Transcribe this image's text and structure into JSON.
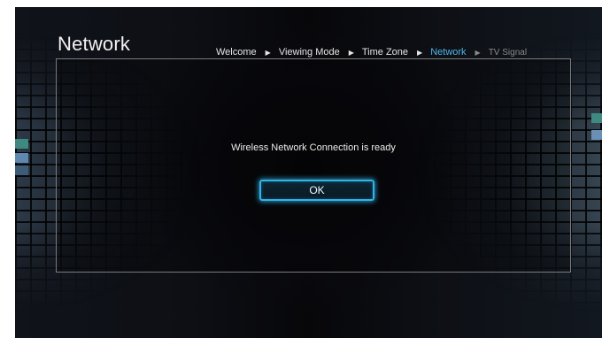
{
  "page": {
    "title": "Network"
  },
  "breadcrumb": {
    "steps": [
      {
        "label": "Welcome",
        "state": "completed"
      },
      {
        "label": "Viewing Mode",
        "state": "completed"
      },
      {
        "label": "Time Zone",
        "state": "completed"
      },
      {
        "label": "Network",
        "state": "current"
      },
      {
        "label": "TV Signal",
        "state": "upcoming"
      }
    ],
    "separator_icon": "play-triangle-icon"
  },
  "dialog": {
    "message": "Wireless Network Connection is ready",
    "ok_label": "OK"
  },
  "colors": {
    "active_step": "#4fb6e8",
    "button_glow": "#2fb4e8",
    "background": "#07070a"
  }
}
